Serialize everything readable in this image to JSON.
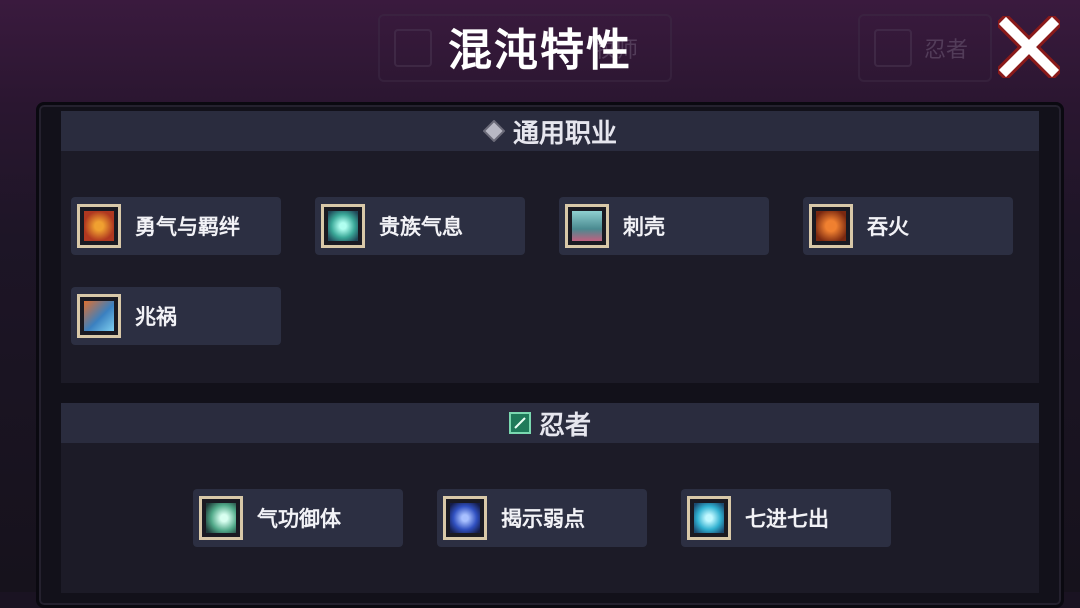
{
  "header": {
    "title": "混沌特性"
  },
  "background_tabs": [
    {
      "label": "牧师"
    },
    {
      "label": "忍者"
    }
  ],
  "sections": [
    {
      "title": "通用职业",
      "icon": "diamond-icon",
      "traits": [
        {
          "label": "勇气与羁绊",
          "icon": "shield-flame-icon",
          "color": "#c8582a"
        },
        {
          "label": "贵族气息",
          "icon": "noble-orb-icon",
          "color": "#5bd0c0"
        },
        {
          "label": "刺壳",
          "icon": "spiked-shell-icon",
          "color": "#6fb0b0"
        },
        {
          "label": "吞火",
          "icon": "fire-face-icon",
          "color": "#e0622a"
        },
        {
          "label": "兆祸",
          "icon": "omen-icon",
          "color": "#4a9ad0"
        }
      ]
    },
    {
      "title": "忍者",
      "icon": "ninja-blade-icon",
      "traits": [
        {
          "label": "气功御体",
          "icon": "qigong-icon",
          "color": "#8fe0c0"
        },
        {
          "label": "揭示弱点",
          "icon": "reveal-weakness-icon",
          "color": "#3a5ad0"
        },
        {
          "label": "七进七出",
          "icon": "swirl-icon",
          "color": "#40c8e0"
        }
      ]
    }
  ]
}
